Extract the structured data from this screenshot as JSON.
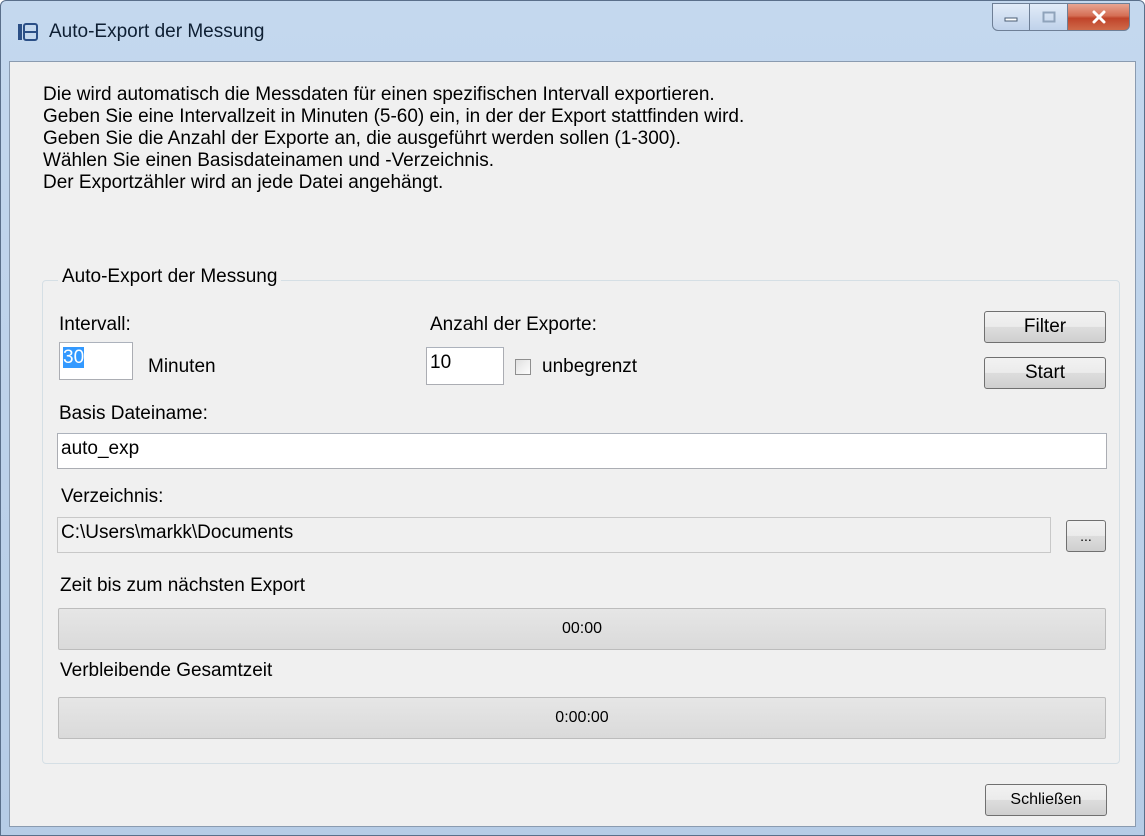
{
  "window": {
    "title": "Auto-Export der Messung"
  },
  "description": [
    "Die wird automatisch die Messdaten für einen spezifischen Intervall exportieren.",
    "Geben Sie eine Intervallzeit in Minuten (5-60) ein, in der der Export stattfinden wird.",
    "Geben Sie die Anzahl der Exporte an, die ausgeführt werden sollen (1-300).",
    "Wählen Sie einen Basisdateinamen und -Verzeichnis.",
    "Der Exportzähler wird an jede Datei angehängt."
  ],
  "group": {
    "title": "Auto-Export der Messung",
    "interval_label": "Intervall:",
    "interval_value": "30",
    "minutes_label": "Minuten",
    "count_label": "Anzahl der Exporte:",
    "count_value": "10",
    "unlimited_label": "unbegrenzt",
    "filter_button": "Filter",
    "start_button": "Start",
    "basename_label": "Basis Dateiname:",
    "basename_value": "auto_exp",
    "directory_label": "Verzeichnis:",
    "directory_value": "C:\\Users\\markk\\Documents",
    "browse_button": "...",
    "next_export_label": "Zeit bis zum nächsten Export",
    "next_export_value": "00:00",
    "remaining_label": "Verbleibende Gesamtzeit",
    "remaining_value": "0:00:00"
  },
  "close_button": "Schließen"
}
